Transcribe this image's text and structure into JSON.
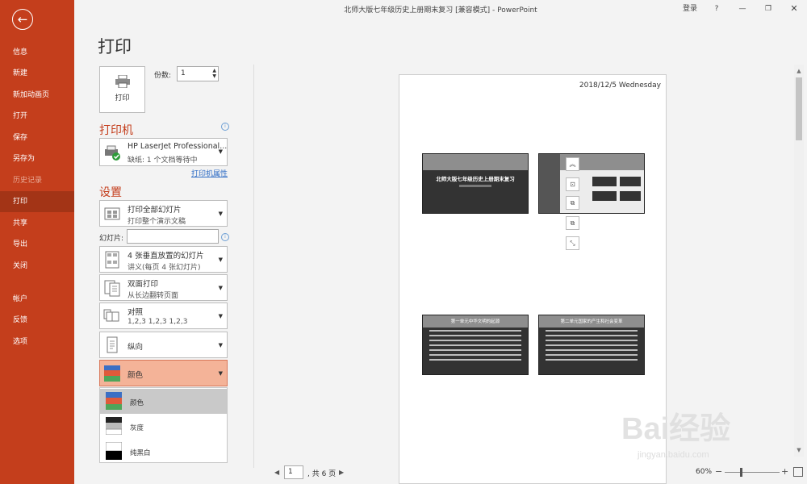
{
  "window": {
    "title": "北师大版七年级历史上册期末复习 [兼容模式] - PowerPoint",
    "login": "登录",
    "help": "?",
    "restore": "❐",
    "close": "✕"
  },
  "sidebar": {
    "back": "←",
    "items": [
      {
        "label": "信息"
      },
      {
        "label": "新建"
      },
      {
        "label": "新加动画页"
      },
      {
        "label": "打开"
      },
      {
        "label": "保存"
      },
      {
        "label": "另存为"
      },
      {
        "label": "历史记录"
      },
      {
        "label": "打印"
      },
      {
        "label": "共享"
      },
      {
        "label": "导出"
      },
      {
        "label": "关闭"
      },
      {
        "label": "帐户"
      },
      {
        "label": "反馈"
      },
      {
        "label": "选项"
      }
    ]
  },
  "print": {
    "title": "打印",
    "button_label": "打印",
    "copies_label": "份数:",
    "copies_value": "1",
    "printer_heading": "打印机",
    "printer_name": "HP LaserJet Professional...",
    "printer_status": "缺纸: 1 个文档等待中",
    "printer_properties": "打印机属性",
    "settings_heading": "设置",
    "slides_range_main": "打印全部幻灯片",
    "slides_range_sub": "打印整个演示文稿",
    "slides_label": "幻灯片:",
    "slides_value": "",
    "layout_main": "4 张垂直放置的幻灯片",
    "layout_sub": "讲义(每页 4 张幻灯片)",
    "duplex_main": "双面打印",
    "duplex_sub": "从长边翻转页面",
    "collate_main": "对照",
    "collate_sub": "1,2,3    1,2,3    1,2,3",
    "orientation": "纵向",
    "color_selected": "颜色",
    "color_options": [
      "颜色",
      "灰度",
      "纯黑白"
    ]
  },
  "preview": {
    "date": "2018/12/5 Wednesday",
    "slide1_title": "北师大版七年级历史上册期末复习",
    "slide3_header": "第一单元中华文明的起源",
    "slide4_header": "第二单元国家的产生和社会变革"
  },
  "bottom": {
    "page_value": "1",
    "page_total": ", 共 6 页",
    "zoom": "60%"
  },
  "watermark": {
    "main": "Bai经验",
    "sub": "jingyan.baidu.com"
  },
  "colors": {
    "accent": "#c43e1c",
    "selected_dropdown": "#f4b398"
  }
}
